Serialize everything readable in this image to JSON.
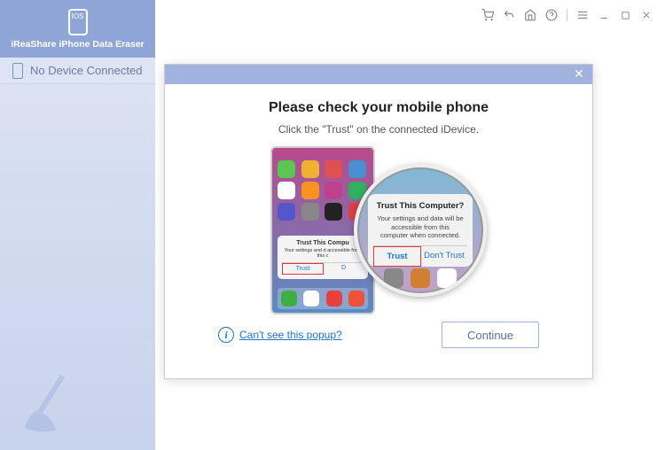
{
  "titlebar": {
    "icons": [
      "cart",
      "back",
      "home",
      "help",
      "menu",
      "min",
      "max",
      "close"
    ]
  },
  "brand": {
    "name": "iReaShare iPhone Data Eraser",
    "badge": "IOS"
  },
  "sidebar": {
    "device_status": "No Device Connected"
  },
  "modal": {
    "title": "Please check your mobile phone",
    "subtitle": "Click the \"Trust\" on the connected iDevice.",
    "phone_dialog": {
      "title": "Trust This Compu",
      "body": "Your settings and d\naccessible from this c",
      "trust": "Trust",
      "dont": "D"
    },
    "zoom_dialog": {
      "title": "Trust This Computer?",
      "body": "Your settings and data will be accessible from this computer when connected.",
      "trust": "Trust",
      "dont": "Don't Trust"
    },
    "help_link": "Can't see this popup?",
    "continue": "Continue"
  },
  "app_colors": [
    "#5ac750",
    "#f0b030",
    "#e05050",
    "#4a90d0",
    "#ffffff",
    "#f7931e",
    "#c04090",
    "#30b060",
    "#5555cc",
    "#888888",
    "#222222",
    "#e04040"
  ],
  "dock_colors": [
    "#3cb043",
    "#ffffff",
    "#e8403a",
    "#f05238"
  ],
  "zoom_app_colors": [
    "#888888",
    "#d08030",
    "#ffffff"
  ]
}
